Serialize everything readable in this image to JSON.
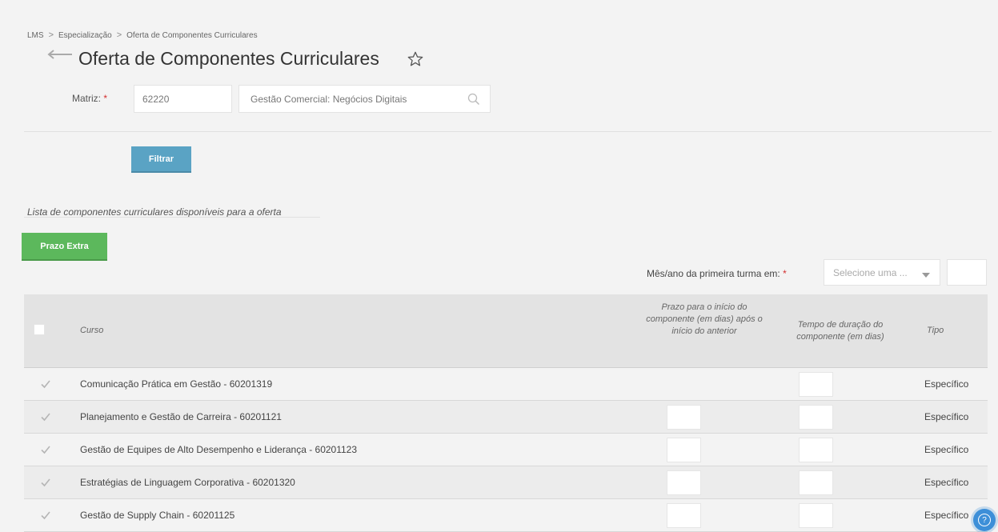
{
  "breadcrumb": {
    "items": [
      "LMS",
      "Especialização",
      "Oferta de Componentes Curriculares"
    ],
    "separator": ">"
  },
  "page": {
    "title": "Oferta de Componentes Curriculares"
  },
  "filter": {
    "matriz_label": "Matriz:",
    "required_mark": "*",
    "matriz_code": "62220",
    "matriz_name": "Gestão Comercial: Negócios Digitais",
    "filter_button": "Filtrar"
  },
  "list": {
    "title": "Lista de componentes curriculares disponíveis para a oferta",
    "prazo_extra_button": "Prazo Extra",
    "mes_label": "Mês/ano da primeira turma em:",
    "mes_placeholder": "Selecione uma ..."
  },
  "table": {
    "headers": {
      "curso": "Curso",
      "prazo": "Prazo para o início do componente (em dias) após o início do anterior",
      "tempo": "Tempo de duração do componente (em dias)",
      "tipo": "Tipo"
    },
    "rows": [
      {
        "curso": "Comunicação Prática em Gestão - 60201319",
        "tipo": "Específico",
        "checked": true,
        "has_prazo": false
      },
      {
        "curso": "Planejamento e Gestão de Carreira - 60201121",
        "tipo": "Específico",
        "checked": true,
        "has_prazo": true
      },
      {
        "curso": "Gestão de Equipes de Alto Desempenho e Liderança - 60201123",
        "tipo": "Específico",
        "checked": true,
        "has_prazo": true
      },
      {
        "curso": "Estratégias de Linguagem Corporativa - 60201320",
        "tipo": "Específico",
        "checked": true,
        "has_prazo": true
      },
      {
        "curso": "Gestão de Supply Chain - 60201125",
        "tipo": "Específico",
        "checked": true,
        "has_prazo": true
      }
    ]
  },
  "help": {
    "icon": "question-icon",
    "glyph": "?"
  },
  "colors": {
    "filtrar": "#5aa3c4",
    "prazo_extra": "#5cb85c",
    "required": "#d32f2f",
    "help": "#3d8fd8"
  }
}
